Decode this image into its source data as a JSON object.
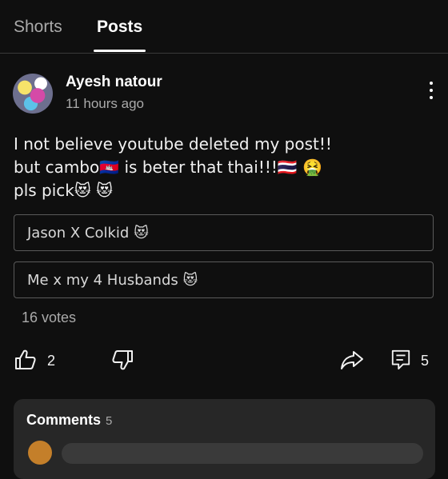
{
  "tabs": [
    {
      "label": "Shorts"
    },
    {
      "label": "Posts"
    }
  ],
  "post": {
    "author": "Ayesh natour",
    "time": "11 hours ago",
    "lines": [
      "I not believe youtube deleted my post!!",
      "but cambo🇰🇭 is beter that thai!!!🇹🇭 🤮",
      "pls pick😻 😻"
    ]
  },
  "poll": {
    "options": [
      {
        "label": "Jason X Colkid 😻"
      },
      {
        "label": "Me x my 4 Husbands 😻"
      }
    ],
    "votes": "16 votes"
  },
  "actions": {
    "likes": "2",
    "comments": "5"
  },
  "comments": {
    "title": "Comments",
    "count": "5"
  },
  "icons": [
    "more-vert-icon",
    "thumb-up-icon",
    "thumb-down-icon",
    "share-icon",
    "comment-icon"
  ]
}
